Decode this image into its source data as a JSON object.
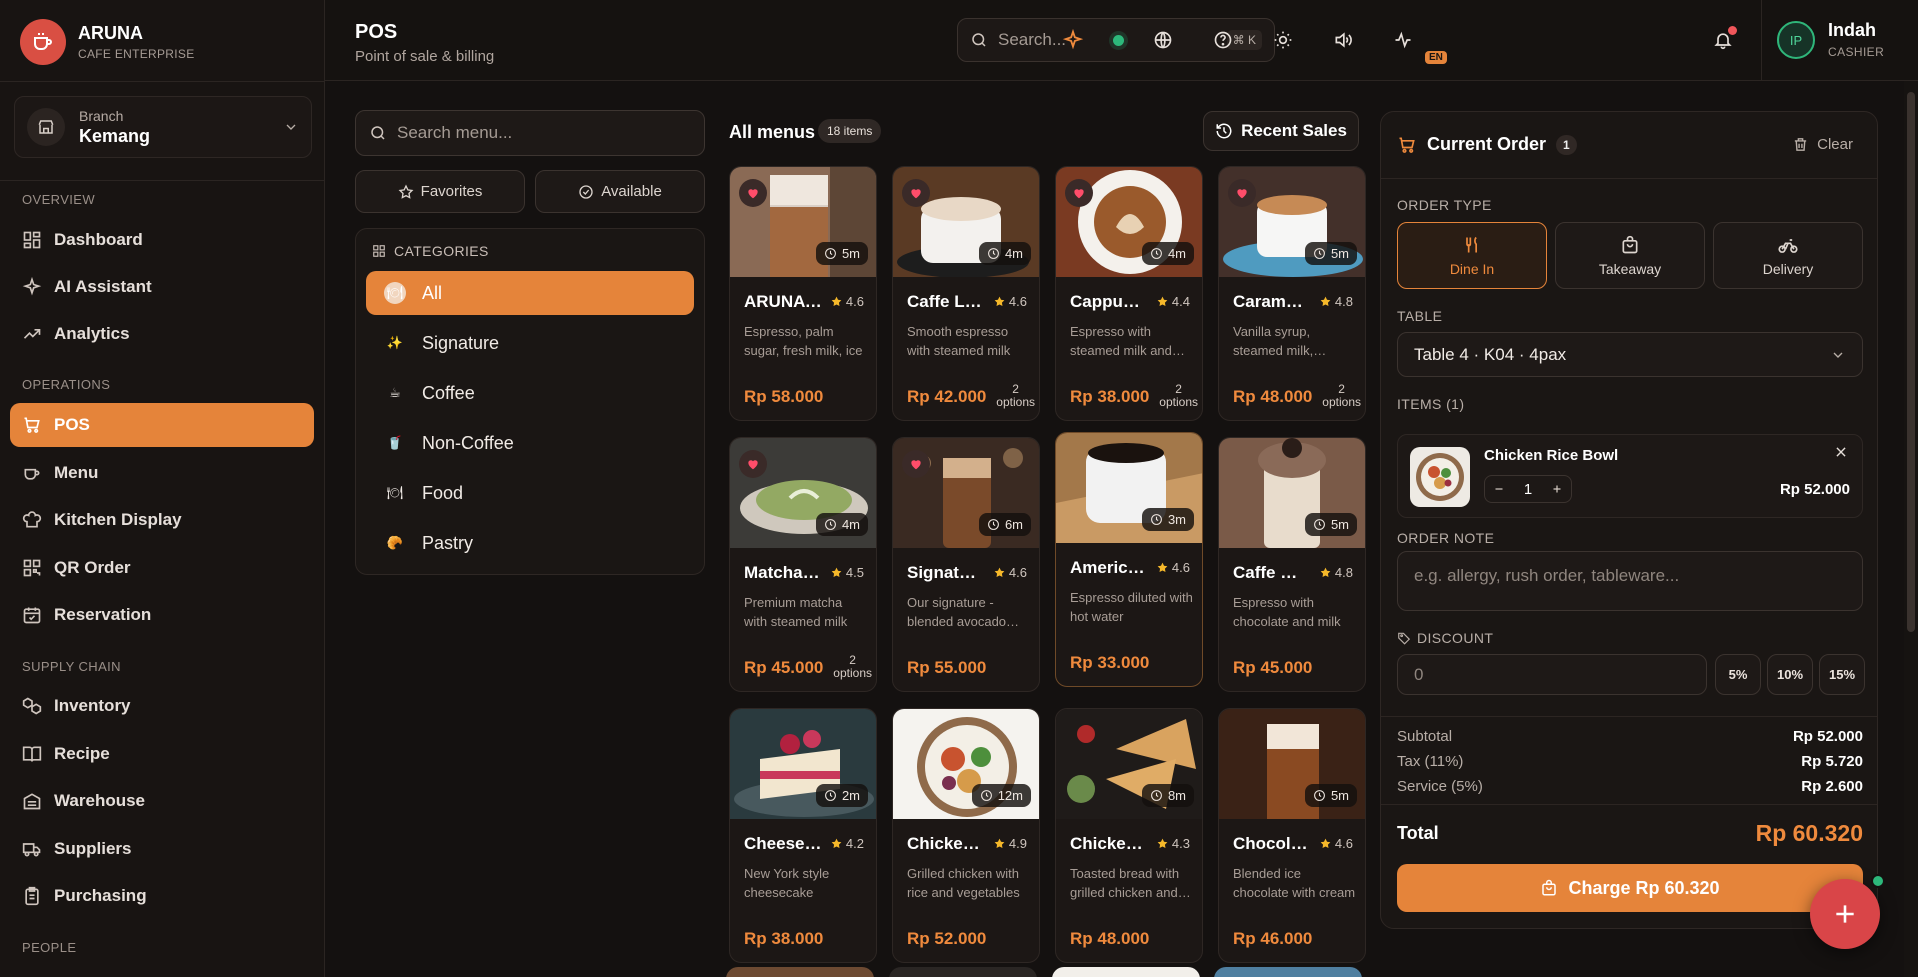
{
  "brand": {
    "name": "ARUNA",
    "subtitle": "CAFE ENTERPRISE",
    "accent": "#e5843a",
    "logo_color": "#d94f43"
  },
  "branch": {
    "label": "Branch",
    "value": "Kemang"
  },
  "sidebar": {
    "sections": [
      "OVERVIEW",
      "OPERATIONS",
      "SUPPLY CHAIN",
      "PEOPLE"
    ],
    "items": [
      {
        "label": "Dashboard",
        "icon": "dashboard-icon"
      },
      {
        "label": "AI Assistant",
        "icon": "sparkle-icon"
      },
      {
        "label": "Analytics",
        "icon": "trend-icon"
      },
      {
        "label": "POS",
        "icon": "cart-icon",
        "active": true
      },
      {
        "label": "Menu",
        "icon": "cup-icon"
      },
      {
        "label": "Kitchen Display",
        "icon": "chef-hat-icon"
      },
      {
        "label": "QR Order",
        "icon": "qr-icon"
      },
      {
        "label": "Reservation",
        "icon": "calendar-icon"
      },
      {
        "label": "Inventory",
        "icon": "boxes-icon"
      },
      {
        "label": "Recipe",
        "icon": "book-icon"
      },
      {
        "label": "Warehouse",
        "icon": "warehouse-icon"
      },
      {
        "label": "Suppliers",
        "icon": "truck-icon"
      },
      {
        "label": "Purchasing",
        "icon": "clipboard-icon"
      }
    ]
  },
  "header": {
    "title": "POS",
    "subtitle": "Point of sale & billing",
    "search_placeholder": "Search...",
    "search_shortcut": "⌘ K",
    "language_badge": "EN",
    "user_initials": "IP",
    "user_name": "Indah",
    "user_role": "CASHIER"
  },
  "filters": {
    "search_placeholder": "Search menu...",
    "favorites_label": "Favorites",
    "available_label": "Available",
    "categories_title": "CATEGORIES",
    "categories": [
      {
        "label": "All",
        "emoji": "🍽",
        "active": true
      },
      {
        "label": "Signature",
        "emoji": "✨"
      },
      {
        "label": "Coffee",
        "emoji": "☕"
      },
      {
        "label": "Non-Coffee",
        "emoji": "🥤"
      },
      {
        "label": "Food",
        "emoji": "🍽"
      },
      {
        "label": "Pastry",
        "emoji": "🥐"
      }
    ]
  },
  "grid": {
    "title": "All menus",
    "count": "18 items",
    "recent_sales_label": "Recent Sales",
    "items": [
      {
        "name": "ARUNA Signature",
        "rating": "4.6",
        "desc": "Espresso, palm sugar, fresh milk, ice",
        "price": "Rp 58.000",
        "time": "5m",
        "fav": true,
        "options": "",
        "img": "iced-latte"
      },
      {
        "name": "Caffe Latte",
        "rating": "4.6",
        "desc": "Smooth espresso with steamed milk",
        "price": "Rp 42.000",
        "time": "4m",
        "fav": true,
        "options": "2",
        "img": "latte"
      },
      {
        "name": "Cappuccino",
        "rating": "4.4",
        "desc": "Espresso with steamed milk and foam",
        "price": "Rp 38.000",
        "time": "4m",
        "fav": true,
        "options": "2",
        "img": "cappuccino"
      },
      {
        "name": "Caramel Macchiato",
        "rating": "4.8",
        "desc": "Vanilla syrup, steamed milk, caramel",
        "price": "Rp 48.000",
        "time": "5m",
        "fav": true,
        "options": "2",
        "img": "macchiato"
      },
      {
        "name": "Matcha Latte",
        "rating": "4.5",
        "desc": "Premium matcha with steamed milk",
        "price": "Rp 45.000",
        "time": "4m",
        "fav": true,
        "options": "2",
        "img": "matcha"
      },
      {
        "name": "Signature Avocado",
        "rating": "4.6",
        "desc": "Our signature - blended avocado coffee",
        "price": "Rp 55.000",
        "time": "6m",
        "fav": true,
        "options": "",
        "img": "avocado"
      },
      {
        "name": "Americano",
        "rating": "4.6",
        "desc": "Espresso diluted with hot water",
        "price": "Rp 33.000",
        "time": "3m",
        "fav": false,
        "options": "",
        "img": "americano",
        "selected": true
      },
      {
        "name": "Caffe Mocha",
        "rating": "4.8",
        "desc": "Espresso with chocolate and milk",
        "price": "Rp 45.000",
        "time": "5m",
        "fav": false,
        "options": "",
        "img": "mocha"
      },
      {
        "name": "Cheesecake",
        "rating": "4.2",
        "desc": "New York style cheesecake",
        "price": "Rp 38.000",
        "time": "2m",
        "fav": false,
        "options": "",
        "img": "cheesecake"
      },
      {
        "name": "Chicken Rice Bowl",
        "rating": "4.9",
        "desc": "Grilled chicken with rice and vegetables",
        "price": "Rp 52.000",
        "time": "12m",
        "fav": false,
        "options": "",
        "img": "rice-bowl"
      },
      {
        "name": "Chicken Sandwich",
        "rating": "4.3",
        "desc": "Toasted bread with grilled chicken and cheese",
        "price": "Rp 48.000",
        "time": "8m",
        "fav": false,
        "options": "",
        "img": "sandwich"
      },
      {
        "name": "Chocolate Frappe",
        "rating": "4.6",
        "desc": "Blended ice chocolate with cream",
        "price": "Rp 46.000",
        "time": "5m",
        "fav": false,
        "options": "",
        "img": "iced-choco"
      }
    ],
    "options_label": "options"
  },
  "order": {
    "title": "Current Order",
    "count": "1",
    "clear_label": "Clear",
    "type_label": "ORDER TYPE",
    "types": [
      {
        "label": "Dine In",
        "active": true
      },
      {
        "label": "Takeaway"
      },
      {
        "label": "Delivery"
      }
    ],
    "table_label": "TABLE",
    "table_value": "Table 4 · K04 · 4pax",
    "items_label": "ITEMS (1)",
    "item": {
      "name": "Chicken Rice Bowl",
      "qty": "1",
      "price": "Rp 52.000"
    },
    "note_label": "ORDER NOTE",
    "note_placeholder": "e.g. allergy, rush order, tableware...",
    "discount_label": "DISCOUNT",
    "discount_placeholder": "0",
    "discount_presets": [
      "5%",
      "10%",
      "15%"
    ],
    "subtotal_label": "Subtotal",
    "subtotal": "Rp 52.000",
    "tax_label": "Tax (11%)",
    "tax": "Rp 5.720",
    "service_label": "Service (5%)",
    "service": "Rp 2.600",
    "total_label": "Total",
    "total": "Rp 60.320",
    "charge_label": "Charge Rp 60.320"
  }
}
